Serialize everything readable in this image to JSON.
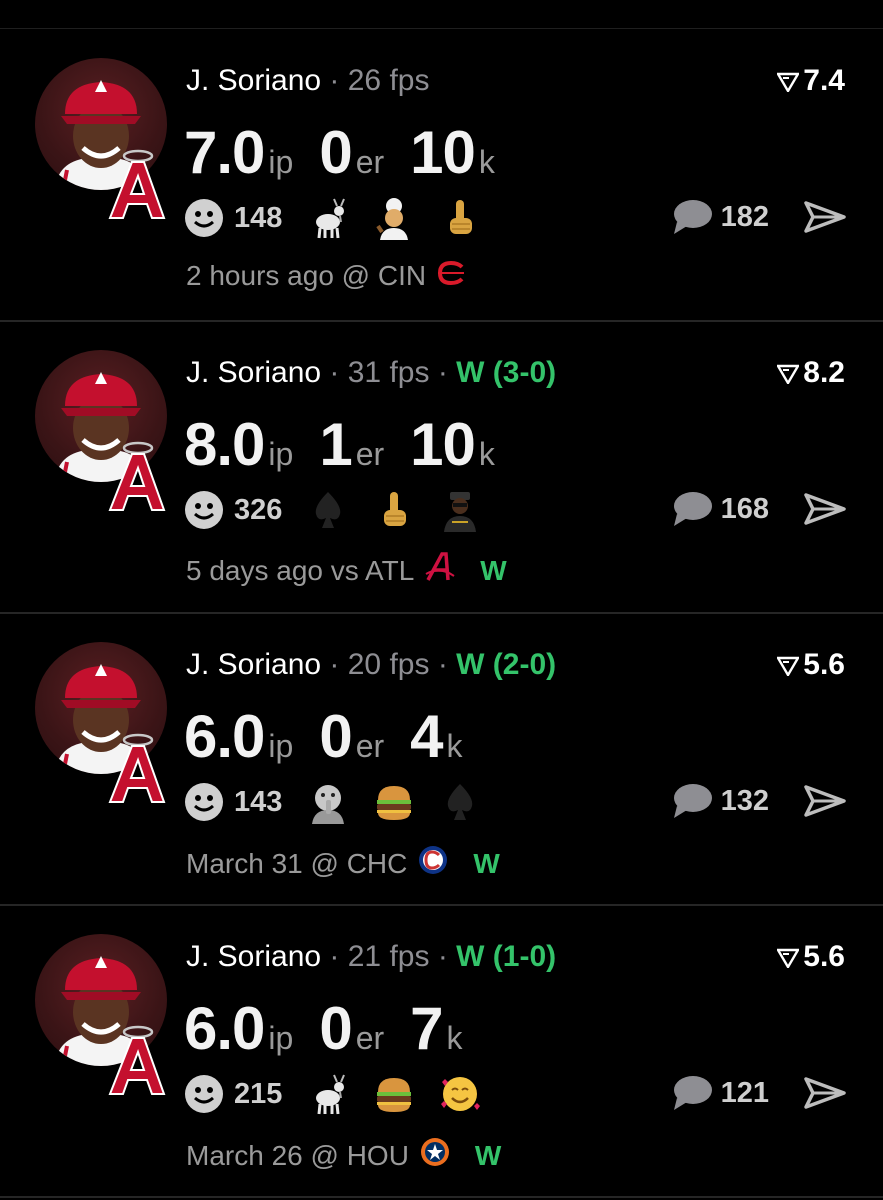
{
  "feed": [
    {
      "name": "J. Soriano",
      "fps": "26 fps",
      "record": "",
      "score": "7.4",
      "ip": "7.0",
      "ip_unit": "ip",
      "er": "0",
      "er_unit": "er",
      "k": "10",
      "k_unit": "k",
      "likes": "148",
      "emojis": [
        "goat-icon",
        "chef-icon",
        "middle-finger-icon"
      ],
      "comments": "182",
      "when": "2 hours ago @ CIN",
      "team_icon": "reds-logo-icon",
      "result": ""
    },
    {
      "name": "J. Soriano",
      "fps": "31 fps",
      "record": "W (3-0)",
      "score": "8.2",
      "ip": "8.0",
      "ip_unit": "ip",
      "er": "1",
      "er_unit": "er",
      "k": "10",
      "k_unit": "k",
      "likes": "326",
      "emojis": [
        "spade-icon",
        "middle-finger-icon",
        "rapper-icon"
      ],
      "comments": "168",
      "when": "5 days ago vs ATL",
      "team_icon": "braves-logo-icon",
      "result": "W"
    },
    {
      "name": "J. Soriano",
      "fps": "20 fps",
      "record": "W (2-0)",
      "score": "5.6",
      "ip": "6.0",
      "ip_unit": "ip",
      "er": "0",
      "er_unit": "er",
      "k": "4",
      "k_unit": "k",
      "likes": "143",
      "emojis": [
        "shush-face-icon",
        "burger-icon",
        "spade-icon"
      ],
      "comments": "132",
      "when": "March 31 @ CHC",
      "team_icon": "cubs-logo-icon",
      "result": "W"
    },
    {
      "name": "J. Soriano",
      "fps": "21 fps",
      "record": "W (1-0)",
      "score": "5.6",
      "ip": "6.0",
      "ip_unit": "ip",
      "er": "0",
      "er_unit": "er",
      "k": "7",
      "k_unit": "k",
      "likes": "215",
      "emojis": [
        "goat-icon",
        "burger-icon",
        "hearts-face-icon"
      ],
      "comments": "121",
      "when": "March 26 @ HOU",
      "team_icon": "astros-logo-icon",
      "result": "W"
    }
  ],
  "colors": {
    "background": "#000000",
    "win_green": "#34c36a",
    "muted": "#8e8e93",
    "angels_red": "#c4102e"
  }
}
